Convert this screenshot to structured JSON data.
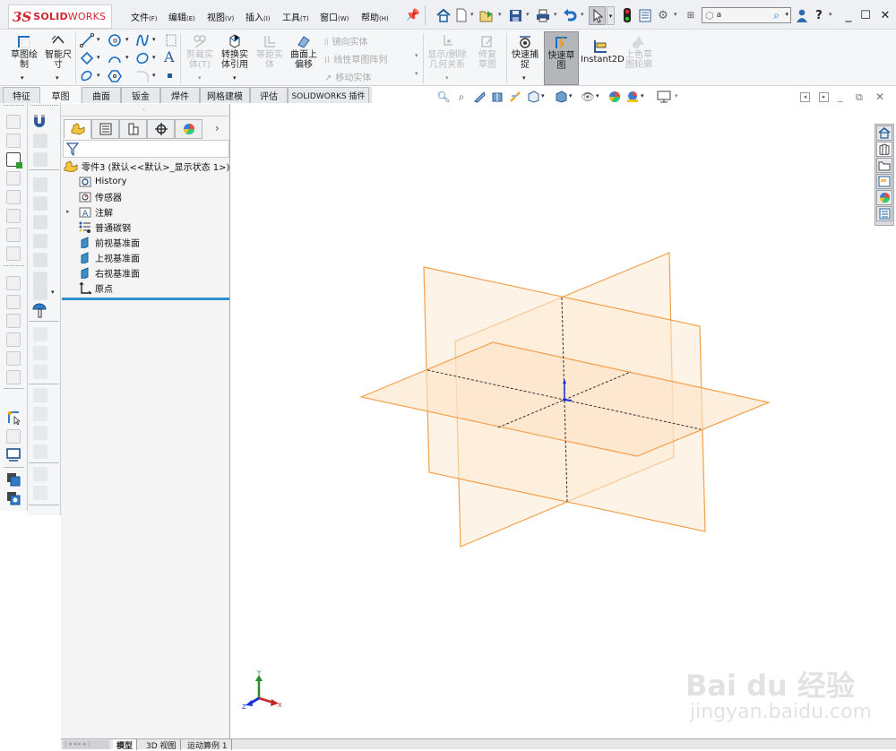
{
  "app": {
    "logo_ds": "3S",
    "logo_solid": "SOLID",
    "logo_works": "WORKS"
  },
  "menu": [
    {
      "label": "文件",
      "key": "(F)"
    },
    {
      "label": "编辑",
      "key": "(E)"
    },
    {
      "label": "视图",
      "key": "(V)"
    },
    {
      "label": "插入",
      "key": "(I)"
    },
    {
      "label": "工具",
      "key": "(T)"
    },
    {
      "label": "窗口",
      "key": "(W)"
    },
    {
      "label": "帮助",
      "key": "(H)"
    }
  ],
  "quick_toolbar": {
    "icons": [
      "home-icon",
      "new-document-icon",
      "open-icon",
      "save-icon",
      "print-icon",
      "undo-icon",
      "select-icon",
      "traffic-light-icon",
      "file-properties-icon",
      "options-gear-icon",
      "customize-icon"
    ],
    "search_value": "a",
    "help_label": "?"
  },
  "window_controls": {
    "minimize": "_",
    "maximize": "☐",
    "close": "✕"
  },
  "ribbon": {
    "sketch": "草图绘制",
    "smart_dimension": "智能尺寸",
    "trim": "剪裁实体(T)",
    "convert": "转换实体引用",
    "offset": "等距实体",
    "surface_offset": "曲面上偏移",
    "mirror": "镜向实体",
    "linear_pattern": "线性草图阵列",
    "move": "移动实体",
    "display_relations": "显示/删除几何关系",
    "repair": "修复草图",
    "quick_snaps": "快速捕捉",
    "rapid_sketch": "快速草图",
    "instant2d": "Instant2D",
    "shaded_contours": "上色草图轮廓"
  },
  "tabs": [
    {
      "label": "特征",
      "active": false
    },
    {
      "label": "草图",
      "active": true
    },
    {
      "label": "曲面",
      "active": false
    },
    {
      "label": "钣金",
      "active": false
    },
    {
      "label": "焊件",
      "active": false
    },
    {
      "label": "网格建模",
      "active": false
    },
    {
      "label": "评估",
      "active": false
    },
    {
      "label": "SOLIDWORKS 插件",
      "active": false
    }
  ],
  "feature_tree": {
    "root": "零件3  (默认<<默认>_显示状态 1>)",
    "items": [
      {
        "label": "History",
        "icon": "history-folder-icon",
        "expandable": false
      },
      {
        "label": "传感器",
        "icon": "sensor-folder-icon",
        "expandable": false
      },
      {
        "label": "注解",
        "icon": "annotation-folder-icon",
        "expandable": true
      },
      {
        "label": "普通碳钢",
        "icon": "material-icon",
        "expandable": false
      },
      {
        "label": "前视基准面",
        "icon": "plane-icon",
        "expandable": false
      },
      {
        "label": "上视基准面",
        "icon": "plane-icon",
        "expandable": false
      },
      {
        "label": "右视基准面",
        "icon": "plane-icon",
        "expandable": false
      },
      {
        "label": "原点",
        "icon": "origin-icon",
        "expandable": false
      }
    ]
  },
  "manager_tabs": [
    "featuremanager-tab",
    "propertymanager-tab",
    "configurationmanager-tab",
    "dimxpert-tab",
    "display-manager-tab"
  ],
  "triad": {
    "x": "X",
    "y": "Y",
    "z": "Z"
  },
  "bottom_tabs": [
    {
      "label": "模型",
      "active": true
    },
    {
      "label": "3D 视图",
      "active": false
    },
    {
      "label": "运动算例 1",
      "active": false
    }
  ],
  "watermark": {
    "brand": "Bai du 经验",
    "url": "jingyan.baidu.com"
  },
  "colors": {
    "plane_edge": "#f3a04a",
    "plane_fill": "#fde3c6",
    "accent": "#2f8fcf"
  }
}
